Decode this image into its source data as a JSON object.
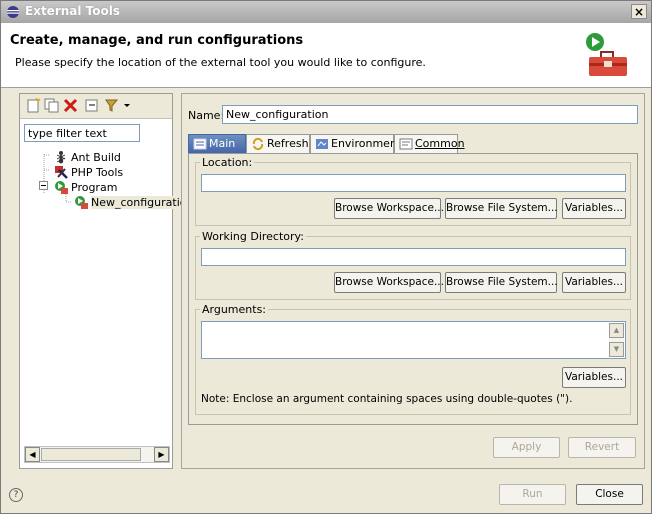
{
  "window": {
    "title": "External Tools",
    "close_glyph": "×"
  },
  "header": {
    "title": "Create, manage, and run configurations",
    "description": "Please specify the location of the external tool you would like to configure."
  },
  "left_panel": {
    "filter_value": "type filter text",
    "tree": [
      {
        "label": "Ant Build",
        "icon": "ant-icon",
        "level": 1
      },
      {
        "label": "PHP Tools",
        "icon": "php-tools-icon",
        "level": 1
      },
      {
        "label": "Program",
        "icon": "program-icon",
        "level": 1
      },
      {
        "label": "New_configuratio",
        "icon": "program-config-icon",
        "level": 2,
        "selected": true
      }
    ],
    "scroll_left_glyph": "◀",
    "scroll_right_glyph": "▶"
  },
  "config": {
    "name_label": "Name:",
    "name_value": "New_configuration",
    "tabs": [
      {
        "label": "Main",
        "icon": "main-tab-icon",
        "active": true
      },
      {
        "label": "Refresh",
        "icon": "refresh-icon",
        "active": false
      },
      {
        "label": "Environment",
        "icon": "environment-icon",
        "active": false
      },
      {
        "label": "Common",
        "icon": "common-icon",
        "active": false
      }
    ],
    "location": {
      "title": "Location:",
      "value": "",
      "browse_workspace": "Browse Workspace...",
      "browse_file_system": "Browse File System...",
      "variables": "Variables..."
    },
    "working_directory": {
      "title": "Working Directory:",
      "value": "",
      "browse_workspace": "Browse Workspace...",
      "browse_file_system": "Browse File System...",
      "variables": "Variables..."
    },
    "arguments": {
      "title": "Arguments:",
      "value": "",
      "variables": "Variables...",
      "note": "Note: Enclose an argument containing spaces using double-quotes (\")."
    },
    "apply_label": "Apply",
    "revert_label": "Revert"
  },
  "footer": {
    "help_glyph": "?",
    "run_label": "Run",
    "close_label": "Close"
  },
  "colors": {
    "dialog_bg": "#ece9d8",
    "active_tab": "#4466a8",
    "titlebar": "#a6a6a6"
  }
}
